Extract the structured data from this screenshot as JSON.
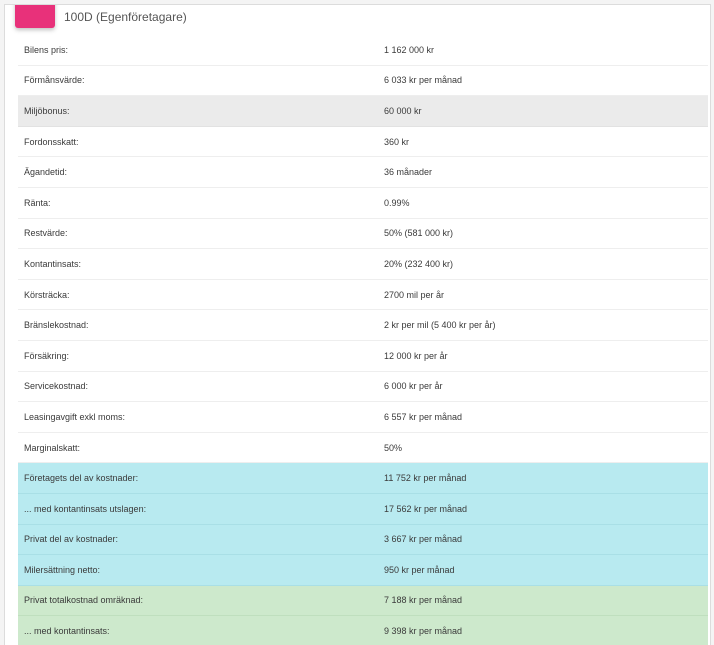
{
  "header": {
    "badge_icon": "car-icon",
    "subtitle": "100D (Egenföretagare)"
  },
  "colors": {
    "badge": "#e8317a",
    "highlight_gray": "#ebebeb",
    "highlight_cyan": "#b8eaf0",
    "highlight_green": "#cde9cc"
  },
  "rows": [
    {
      "label": "Bilens pris:",
      "value": "1 162 000 kr",
      "style": "plain"
    },
    {
      "label": "Förmånsvärde:",
      "value": "6 033 kr per månad",
      "style": "plain"
    },
    {
      "label": "Miljöbonus:",
      "value": "60 000 kr",
      "style": "gray"
    },
    {
      "label": "Fordonsskatt:",
      "value": "360 kr",
      "style": "plain"
    },
    {
      "label": "Ägandetid:",
      "value": "36 månader",
      "style": "plain"
    },
    {
      "label": "Ränta:",
      "value": "0.99%",
      "style": "plain"
    },
    {
      "label": "Restvärde:",
      "value": "50% (581 000 kr)",
      "style": "plain"
    },
    {
      "label": "Kontantinsats:",
      "value": "20% (232 400 kr)",
      "style": "plain"
    },
    {
      "label": "Körsträcka:",
      "value": "2700 mil per år",
      "style": "plain"
    },
    {
      "label": "Bränslekostnad:",
      "value": "2 kr per mil (5 400 kr per år)",
      "style": "plain"
    },
    {
      "label": "Försäkring:",
      "value": "12 000 kr per år",
      "style": "plain"
    },
    {
      "label": "Servicekostnad:",
      "value": "6 000 kr per år",
      "style": "plain"
    },
    {
      "label": "Leasingavgift exkl moms:",
      "value": "6 557 kr per månad",
      "style": "plain"
    },
    {
      "label": "Marginalskatt:",
      "value": "50%",
      "style": "plain"
    },
    {
      "label": "Företagets del av kostnader:",
      "value": "11 752 kr per månad",
      "style": "cyan"
    },
    {
      "label": "... med kontantinsats utslagen:",
      "value": "17 562 kr per månad",
      "style": "cyan"
    },
    {
      "label": "Privat del av kostnader:",
      "value": "3 667 kr per månad",
      "style": "cyan"
    },
    {
      "label": "Milersättning netto:",
      "value": "950 kr per månad",
      "style": "cyan"
    },
    {
      "label": "Privat totalkostnad omräknad:",
      "value": "7 188 kr per månad",
      "style": "green"
    },
    {
      "label": "... med kontantinsats:",
      "value": "9 398 kr per månad",
      "style": "green"
    }
  ]
}
